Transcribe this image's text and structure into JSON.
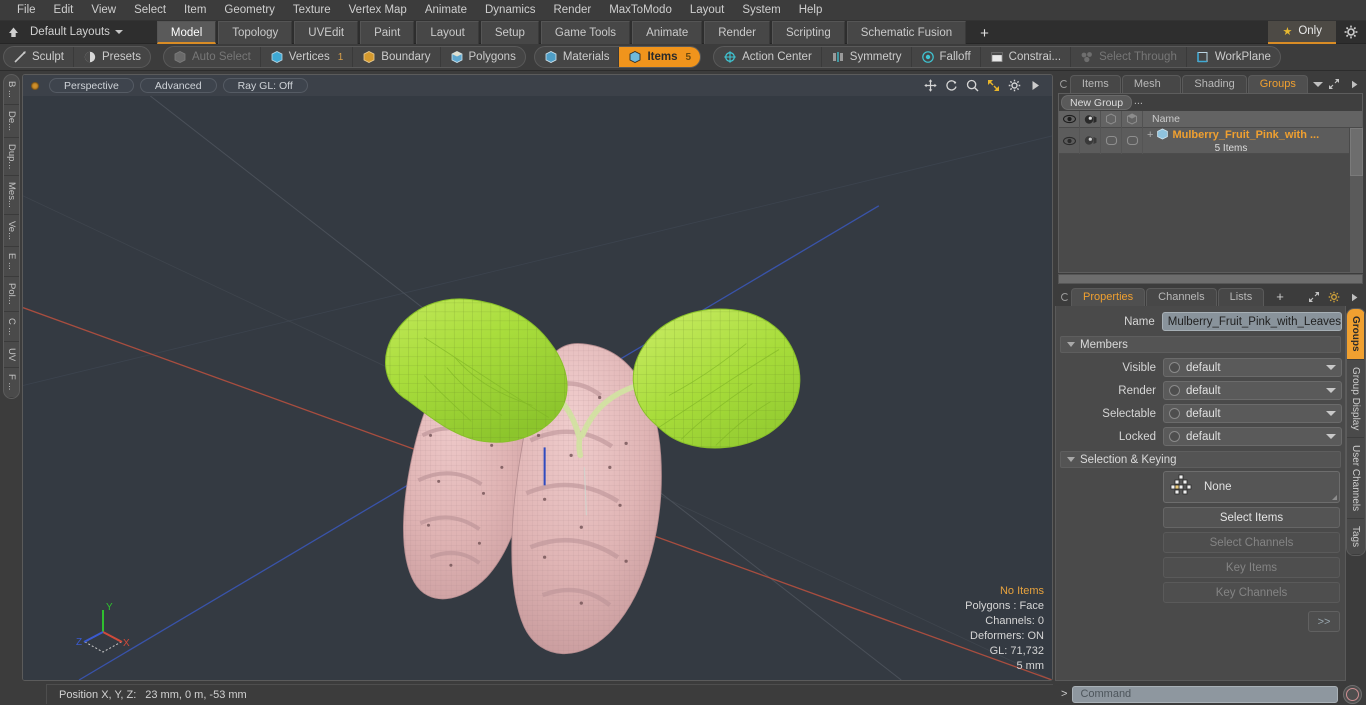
{
  "menubar": {
    "items": [
      {
        "label": "File"
      },
      {
        "label": "Edit"
      },
      {
        "label": "View"
      },
      {
        "label": "Select"
      },
      {
        "label": "Item"
      },
      {
        "label": "Geometry"
      },
      {
        "label": "Texture"
      },
      {
        "label": "Vertex Map"
      },
      {
        "label": "Animate"
      },
      {
        "label": "Dynamics"
      },
      {
        "label": "Render"
      },
      {
        "label": "MaxToModo"
      },
      {
        "label": "Layout"
      },
      {
        "label": "System"
      },
      {
        "label": "Help"
      }
    ]
  },
  "layoutbar": {
    "home_icon": "home-icon",
    "preset_label": "Default Layouts",
    "tabs": [
      {
        "label": "Model",
        "active": true
      },
      {
        "label": "Topology",
        "active": false
      },
      {
        "label": "UVEdit",
        "active": false
      },
      {
        "label": "Paint",
        "active": false
      },
      {
        "label": "Layout",
        "active": false
      },
      {
        "label": "Setup",
        "active": false
      },
      {
        "label": "Game Tools",
        "active": false
      },
      {
        "label": "Animate",
        "active": false
      },
      {
        "label": "Render",
        "active": false
      },
      {
        "label": "Scripting",
        "active": false
      },
      {
        "label": "Schematic Fusion",
        "active": false
      }
    ],
    "add_tab_label": "+",
    "only_label": "Only",
    "only_star_icon": "star-icon",
    "gear_icon": "gear-icon"
  },
  "modebar": {
    "group1": [
      {
        "label": "Sculpt",
        "icon": "sculpt-icon",
        "state": "normal"
      },
      {
        "label": "Presets",
        "icon": "presets-icon",
        "state": "normal"
      }
    ],
    "group2": [
      {
        "label": "Auto Select",
        "icon": "cube-icon",
        "state": "dim",
        "count": ""
      },
      {
        "label": "Vertices",
        "icon": "vertices-icon",
        "state": "normal",
        "count": "1"
      },
      {
        "label": "Boundary",
        "icon": "boundary-icon",
        "state": "normal",
        "count": ""
      },
      {
        "label": "Polygons",
        "icon": "polygons-icon",
        "state": "normal",
        "count": ""
      }
    ],
    "group3": [
      {
        "label": "Materials",
        "icon": "materials-icon",
        "state": "normal",
        "count": ""
      },
      {
        "label": "Items",
        "icon": "items-icon",
        "state": "on",
        "count": "5"
      }
    ],
    "group4": [
      {
        "label": "Action Center",
        "icon": "action-center-icon",
        "state": "normal"
      },
      {
        "label": "Symmetry",
        "icon": "symmetry-icon",
        "state": "normal"
      },
      {
        "label": "Falloff",
        "icon": "falloff-icon",
        "state": "normal"
      },
      {
        "label": "Constrai...",
        "icon": "constrain-icon",
        "state": "normal"
      },
      {
        "label": "Select Through",
        "icon": "select-through-icon",
        "state": "dim"
      },
      {
        "label": "WorkPlane",
        "icon": "workplane-icon",
        "state": "normal"
      }
    ]
  },
  "left_tabs": [
    {
      "label": "B ..."
    },
    {
      "label": "De..."
    },
    {
      "label": "Dup..."
    },
    {
      "label": "Mes..."
    },
    {
      "label": "Ve..."
    },
    {
      "label": "E ..."
    },
    {
      "label": "Pol..."
    },
    {
      "label": "C ..."
    },
    {
      "label": "UV"
    },
    {
      "label": "F ..."
    }
  ],
  "viewport": {
    "indicator_icon": "active-viewport-dot",
    "buttons": [
      {
        "label": "Perspective"
      },
      {
        "label": "Advanced"
      },
      {
        "label": "Ray GL: Off"
      }
    ],
    "header_icons": [
      {
        "name": "move-icon"
      },
      {
        "name": "rotate-icon"
      },
      {
        "name": "zoom-icon"
      },
      {
        "name": "fit-icon"
      },
      {
        "name": "gear-icon"
      },
      {
        "name": "play-icon"
      }
    ],
    "stats": {
      "selection": "No Items",
      "polygons": "Polygons : Face",
      "channels": "Channels: 0",
      "deformers": "Deformers: ON",
      "gl": "GL: 71,732",
      "grid": "5 mm"
    },
    "axis": {
      "x": "X",
      "y": "Y",
      "z": "Z"
    },
    "scene": {
      "object": "Mulberry fruit pink with leaves",
      "leaf_color": "#a8dd3a",
      "fruit_color": "#dfb4b4",
      "background_color": "#343a42",
      "x_axis_color": "#b5503f",
      "z_axis_color": "#3a56b5"
    }
  },
  "positionbar": {
    "label": "Position X, Y, Z:",
    "value": "23 mm, 0 m, -53 mm"
  },
  "rightpanel": {
    "top_tabs": [
      {
        "label": "Items",
        "active": false
      },
      {
        "label": "Mesh ...",
        "active": false
      },
      {
        "label": "Shading",
        "active": false
      },
      {
        "label": "Groups",
        "active": true
      }
    ],
    "top_tab_caret_icon": "chevron-down-icon",
    "expand_icon": "expand-icon",
    "play_icon": "play-icon",
    "new_group_label": "New Group",
    "list_columns": [
      {
        "name": "eye-icon"
      },
      {
        "name": "render-icon"
      },
      {
        "name": "lock-box-icon"
      },
      {
        "name": "select-box-icon"
      }
    ],
    "list_name_header": "Name",
    "group_row": {
      "expander": "+",
      "icon": "group-icon",
      "name": "Mulberry_Fruit_Pink_with ...",
      "subtitle": "5 Items"
    },
    "prop_tabs": [
      {
        "label": "Properties",
        "active": true
      },
      {
        "label": "Channels",
        "active": false
      },
      {
        "label": "Lists",
        "active": false
      },
      {
        "label": "+",
        "active": false
      }
    ],
    "prop_expand_icon": "expand-icon",
    "prop_gear_icon": "gear-icon",
    "prop_play_icon": "play-icon",
    "properties": {
      "name_label": "Name",
      "name_value": "Mulberry_Fruit_Pink_with_Leaves",
      "members_section": "Members",
      "fields": [
        {
          "label": "Visible",
          "value": "default"
        },
        {
          "label": "Render",
          "value": "default"
        },
        {
          "label": "Selectable",
          "value": "default"
        },
        {
          "label": "Locked",
          "value": "default"
        }
      ],
      "selection_section": "Selection & Keying",
      "select_mode": "None",
      "select_mode_icon": "selection-grid-icon",
      "buttons": [
        {
          "label": "Select Items",
          "enabled": true
        },
        {
          "label": "Select Channels",
          "enabled": false
        },
        {
          "label": "Key Items",
          "enabled": false
        },
        {
          "label": "Key Channels",
          "enabled": false
        }
      ],
      "more_label": ">>"
    },
    "side_tabs": [
      {
        "label": "Groups",
        "active": true
      },
      {
        "label": "Group Display",
        "active": false
      },
      {
        "label": "User Channels",
        "active": false
      },
      {
        "label": "Tags",
        "active": false
      }
    ]
  },
  "commandbar": {
    "chevron": ">",
    "placeholder": "Command",
    "record_icon": "record-icon"
  }
}
